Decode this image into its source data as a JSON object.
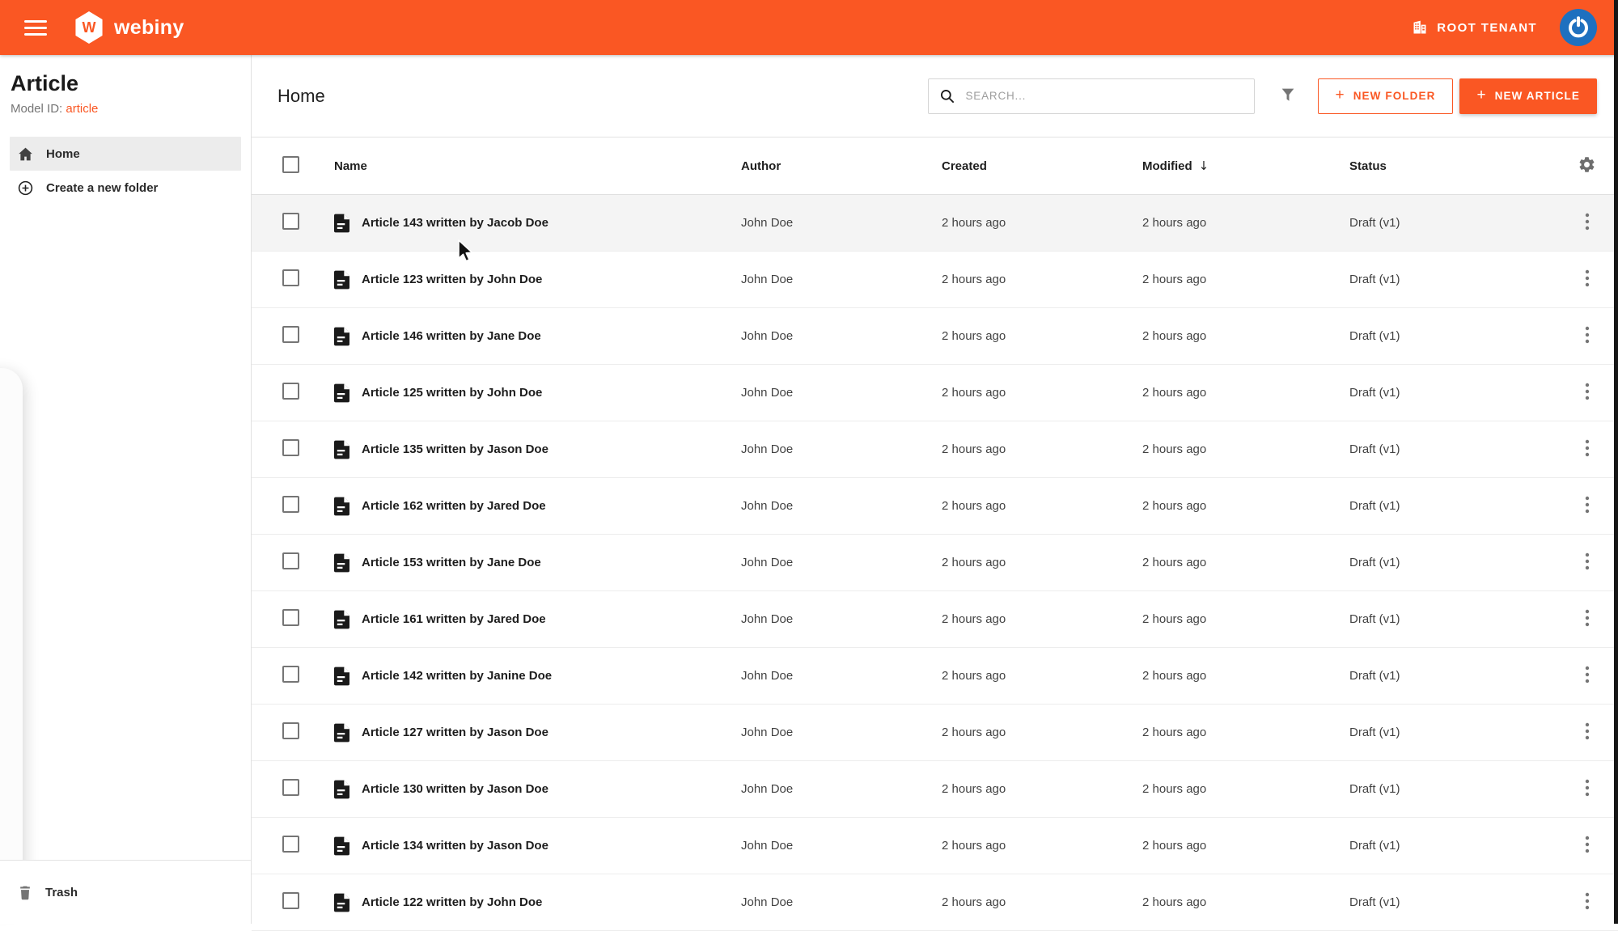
{
  "colors": {
    "accent": "#fa5723",
    "avatar_bg": "#1e70bf",
    "selected_item_bg": "#ececec",
    "hover_row_bg": "#f4f4f4"
  },
  "topbar": {
    "brand": "webiny",
    "brand_letter": "W",
    "tenant_label": "ROOT TENANT"
  },
  "sidebar": {
    "title": "Article",
    "model_id_label": "Model ID:",
    "model_id_value": "article",
    "items": [
      {
        "label": "Home",
        "icon": "home-icon",
        "selected": true
      },
      {
        "label": "Create a new folder",
        "icon": "plus-circle-icon",
        "selected": false
      }
    ],
    "trash_label": "Trash"
  },
  "toolbar": {
    "title": "Home",
    "search_placeholder": "SEARCH...",
    "plus_glyph": "+",
    "new_folder_label": "NEW FOLDER",
    "new_article_label": "NEW ARTICLE"
  },
  "table": {
    "columns": [
      "Name",
      "Author",
      "Created",
      "Modified",
      "Status"
    ],
    "sort_column": "Modified",
    "sort_direction": "desc",
    "sort_indicator": "↓",
    "rows": [
      {
        "name": "Article 143 written by Jacob Doe",
        "author": "John Doe",
        "created": "2 hours ago",
        "modified": "2 hours ago",
        "status": "Draft (v1)",
        "hovered": true
      },
      {
        "name": "Article 123 written by John Doe",
        "author": "John Doe",
        "created": "2 hours ago",
        "modified": "2 hours ago",
        "status": "Draft (v1)",
        "hovered": false
      },
      {
        "name": "Article 146 written by Jane Doe",
        "author": "John Doe",
        "created": "2 hours ago",
        "modified": "2 hours ago",
        "status": "Draft (v1)",
        "hovered": false
      },
      {
        "name": "Article 125 written by John Doe",
        "author": "John Doe",
        "created": "2 hours ago",
        "modified": "2 hours ago",
        "status": "Draft (v1)",
        "hovered": false
      },
      {
        "name": "Article 135 written by Jason Doe",
        "author": "John Doe",
        "created": "2 hours ago",
        "modified": "2 hours ago",
        "status": "Draft (v1)",
        "hovered": false
      },
      {
        "name": "Article 162 written by Jared Doe",
        "author": "John Doe",
        "created": "2 hours ago",
        "modified": "2 hours ago",
        "status": "Draft (v1)",
        "hovered": false
      },
      {
        "name": "Article 153 written by Jane Doe",
        "author": "John Doe",
        "created": "2 hours ago",
        "modified": "2 hours ago",
        "status": "Draft (v1)",
        "hovered": false
      },
      {
        "name": "Article 161 written by Jared Doe",
        "author": "John Doe",
        "created": "2 hours ago",
        "modified": "2 hours ago",
        "status": "Draft (v1)",
        "hovered": false
      },
      {
        "name": "Article 142 written by Janine Doe",
        "author": "John Doe",
        "created": "2 hours ago",
        "modified": "2 hours ago",
        "status": "Draft (v1)",
        "hovered": false
      },
      {
        "name": "Article 127 written by Jason Doe",
        "author": "John Doe",
        "created": "2 hours ago",
        "modified": "2 hours ago",
        "status": "Draft (v1)",
        "hovered": false
      },
      {
        "name": "Article 130 written by Jason Doe",
        "author": "John Doe",
        "created": "2 hours ago",
        "modified": "2 hours ago",
        "status": "Draft (v1)",
        "hovered": false
      },
      {
        "name": "Article 134 written by Jason Doe",
        "author": "John Doe",
        "created": "2 hours ago",
        "modified": "2 hours ago",
        "status": "Draft (v1)",
        "hovered": false
      },
      {
        "name": "Article 122 written by John Doe",
        "author": "John Doe",
        "created": "2 hours ago",
        "modified": "2 hours ago",
        "status": "Draft (v1)",
        "hovered": false
      }
    ]
  },
  "icons": {
    "menu": "hamburger",
    "tenant": "building",
    "avatar": "power-swirl",
    "search": "magnifier",
    "filter": "funnel",
    "settings": "gear",
    "row_menu": "kebab-vertical",
    "file": "document",
    "home": "house",
    "create_folder": "plus-circle",
    "trash": "trash-can"
  }
}
